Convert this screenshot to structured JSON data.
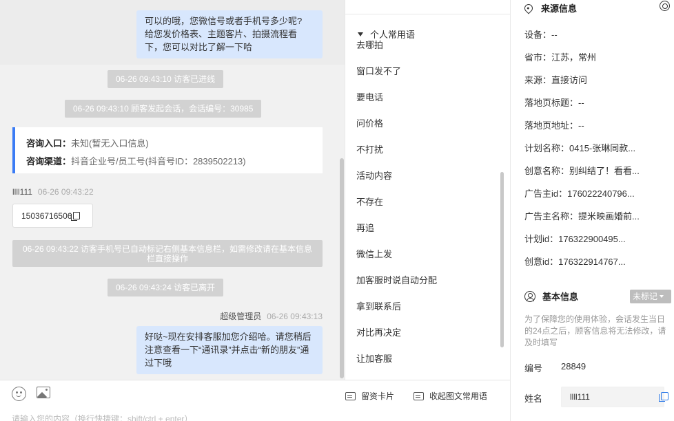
{
  "chat": {
    "top_bubble_lines": [
      "可以的哦，您微信号或者手机号多少呢?",
      "给您发价格表、主题客片、拍摄流程看",
      "下，您可以对比了解一下哈"
    ],
    "sys_visitor_entered": "06-26 09:43:10 访客已进线",
    "sys_session_started": "06-26 09:43:10 顾客发起会话，会话编号：30985",
    "consult_entry_label": "咨询入口：",
    "consult_entry_value": "未知(暂无入口信息)",
    "consult_channel_label": "咨询渠道：",
    "consult_channel_value": "抖音企业号/员工号(抖音号ID：2839502213)",
    "visitor_name": "llll111",
    "visitor_time": "06-26 09:43:22",
    "visitor_phone": "15036716506",
    "sys_auto_mark": "06-26 09:43:22 访客手机号已自动标记右侧基本信息栏，如需修改请在基本信息栏直接操作",
    "sys_visitor_left": "06-26 09:43:24 访客已离开",
    "agent_name": "超级管理员",
    "agent_time": "06-26 09:43:13",
    "agent_bubble_lines": [
      "好哒~现在安排客服加您介绍哈。请您稍后",
      "注意查看一下“通讯录”并点击“新的朋友”通",
      "过下哦"
    ]
  },
  "input": {
    "placeholder": "请输入您的内容（换行快捷键：shift/ctrl + enter）",
    "emoji_icon": "smile-icon",
    "image_icon": "image-icon",
    "card_button": "留资卡片",
    "phrase_button": "收起图文常用语"
  },
  "phrases": {
    "group_title": "个人常用语",
    "items": [
      "去哪拍",
      "窗口发不了",
      "要电话",
      "问价格",
      "不打扰",
      "活动内容",
      "不存在",
      "再追",
      "微信上发",
      "加客服时说自动分配",
      "拿到联系后",
      "对比再决定",
      "让加客服"
    ]
  },
  "panel": {
    "source_title": "来源信息",
    "source_items": [
      "设备：--",
      "省市：江苏，常州",
      "来源：直接访问",
      "落地页标题：--",
      "落地页地址：--",
      "计划名称：0415-张琳同款...",
      "创意名称：别纠结了！看看...",
      "广告主id：176022240796...",
      "广告主名称：提米映画婚前...",
      "计划id：176322900495...",
      "创意id：176322914767..."
    ],
    "basic_title": "基本信息",
    "tag_label": "未标记",
    "notice": "为了保障您的使用体验，会话发生当日的24点之后，顾客信息将无法修改，请及时填写",
    "id_label": "编号",
    "id_value": "28849",
    "name_label": "姓名",
    "name_value": "llll111"
  },
  "colors": {
    "accent": "#3b7cf5",
    "bubble": "#d8e7fd",
    "system": "#d2d2d2"
  }
}
